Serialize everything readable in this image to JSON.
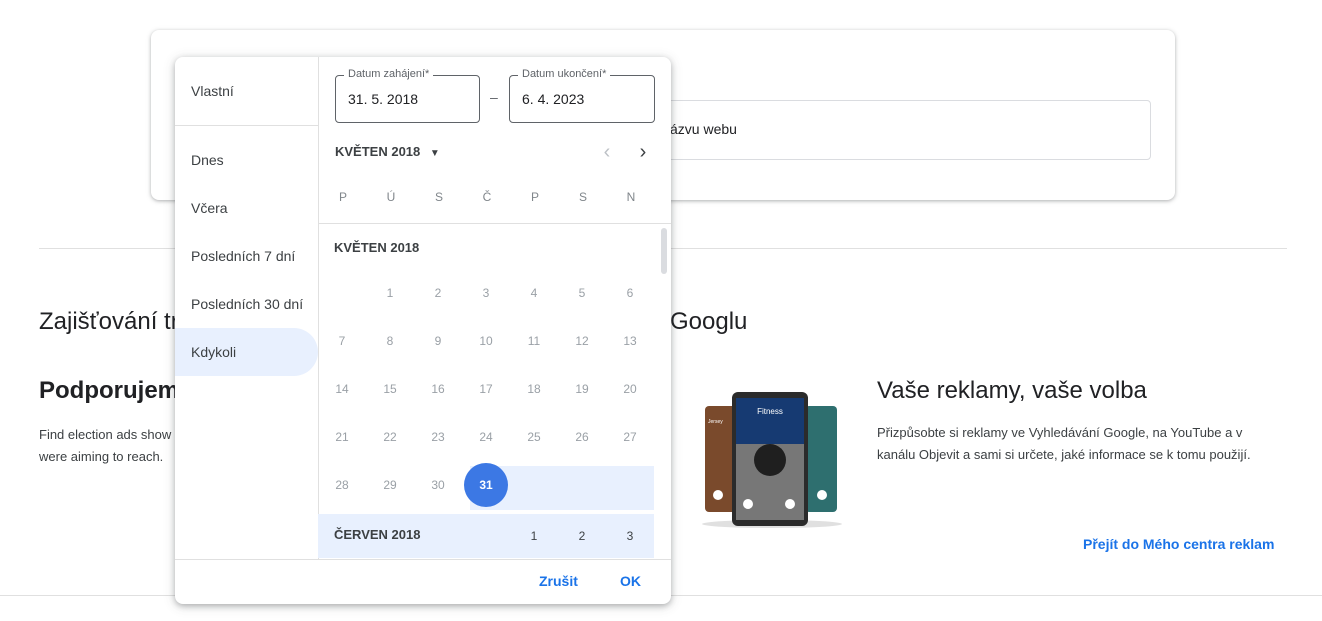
{
  "search": {
    "partial_text": "ázvu webu"
  },
  "section": {
    "title_left": "Zajišťování tr",
    "title_right": "Googlu",
    "subtitle": "Podporujem",
    "desc_line1": "Find election ads show",
    "desc_line2": "were aiming to reach."
  },
  "phones": {
    "label": "Fitness",
    "left_label": "Jersey"
  },
  "promo": {
    "title": "Vaše reklamy, vaše volba",
    "desc": "Přizpůsobte si reklamy ve Vyhledávání Google, na YouTube a v kanálu Objevit a sami si určete, jaké informace se k tomu použijí.",
    "link": "Přejít do Mého centra reklam"
  },
  "picker": {
    "presets": [
      "Vlastní",
      "Dnes",
      "Včera",
      "Posledních 7 dní",
      "Posledních 30 dní",
      "Kdykoli"
    ],
    "active_preset": "Kdykoli",
    "start_label": "Datum zahájení*",
    "start_value": "31. 5. 2018",
    "end_label": "Datum ukončení*",
    "end_value": "6. 4. 2023",
    "dash": "–",
    "month_select": "KVĚTEN 2018",
    "weekdays": [
      "P",
      "Ú",
      "S",
      "Č",
      "P",
      "S",
      "N"
    ],
    "may_head": "KVĚTEN 2018",
    "may_days": [
      "1",
      "2",
      "3",
      "4",
      "5",
      "6",
      "7",
      "8",
      "9",
      "10",
      "11",
      "12",
      "13",
      "14",
      "15",
      "16",
      "17",
      "18",
      "19",
      "20",
      "21",
      "22",
      "23",
      "24",
      "25",
      "26",
      "27",
      "28",
      "29",
      "30",
      "31"
    ],
    "june_head": "ČERVEN 2018",
    "june_days": [
      "1",
      "2",
      "3"
    ],
    "selected_day": "31",
    "cancel": "Zrušit",
    "ok": "OK"
  }
}
